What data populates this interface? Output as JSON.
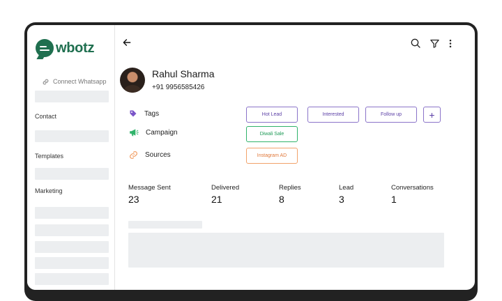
{
  "app": {
    "logo_text": "wbotz"
  },
  "sidebar": {
    "connect_label": "Connect Whatsapp",
    "sections": [
      "Contact",
      "Templates",
      "Marketing"
    ]
  },
  "contact": {
    "name": "Rahul Sharma",
    "phone": "+91 9956585426"
  },
  "attributes": {
    "tags_label": "Tags",
    "campaign_label": "Campaign",
    "sources_label": "Sources",
    "tags": [
      "Hot Lead",
      "Interested",
      "Follow up"
    ],
    "add_label": "+",
    "campaign_value": "Diwali Sale",
    "source_value": "Instagram AD"
  },
  "stats": [
    {
      "label": "Message Sent",
      "value": "23"
    },
    {
      "label": "Delivered",
      "value": "21"
    },
    {
      "label": "Replies",
      "value": "8"
    },
    {
      "label": "Lead",
      "value": "3"
    },
    {
      "label": "Conversations",
      "value": "1"
    }
  ],
  "colors": {
    "brand": "#1f6f4f",
    "tag_purple": "#8a73c9",
    "campaign_green": "#2fb36a",
    "source_orange": "#f2a26a",
    "skeleton": "#eceef0"
  },
  "icons": {
    "back": "arrow-left-icon",
    "search": "search-icon",
    "filter": "filter-icon",
    "more": "more-vertical-icon",
    "link": "link-icon",
    "tag": "tag-icon",
    "campaign": "megaphone-icon",
    "source": "link-icon"
  }
}
